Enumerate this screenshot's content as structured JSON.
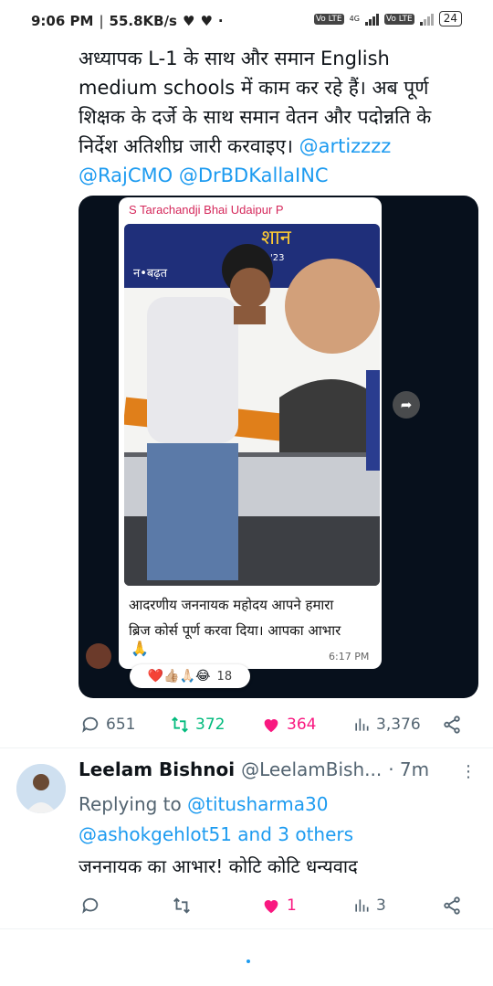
{
  "status": {
    "time": "9:06 PM",
    "speed": "55.8KB/s",
    "network": "4G",
    "battery": "24"
  },
  "tweet": {
    "text_line1": "अध्यापक L-1 के साथ और समान English",
    "text_line2": "medium schools में काम कर रहे हैं। अब पूर्ण",
    "text_line3": "शिक्षक के दर्जे के साथ समान वेतन और पदोन्नति के",
    "text_line4_a": "निर्देश अतिशीघ्र जारी करवाइए। ",
    "mention1": "@artizzzz",
    "mention2": "@RajCMO",
    "mention3": "@DrBDKallaINC"
  },
  "media": {
    "sender": "S Tarachandji Bhai Udaipur P",
    "caption_line1": "आदरणीय जननायक महोदय आपने हमारा",
    "caption_line2": "ब्रिज कोर्स पूर्ण करवा दिया। आपका आभार",
    "caption_emoji": "🙏",
    "time": "6:17 PM",
    "reactions": "❤️👍🏼🙏🏻😂",
    "reaction_count": "18",
    "photo_text1": "शान",
    "photo_text2": "न•बढ़त",
    "photo_text3": "'23"
  },
  "tweet_actions": {
    "replies": "651",
    "retweets": "372",
    "likes": "364",
    "views": "3,376"
  },
  "reply": {
    "name": "Leelam Bishnoi",
    "handle": "@LeelamBish...",
    "time": "· 7m",
    "replying_label": "Replying to ",
    "replying_to1": "@titusharma30",
    "replying_to2": "@ashokgehlot51 and 3 others",
    "text": "जननायक का आभार! कोटि कोटि धन्यवाद",
    "likes": "1",
    "views": "3"
  },
  "colors": {
    "accent": "#1d9bf0",
    "retweet": "#00ba7c",
    "like": "#f91880",
    "muted": "#536471"
  }
}
